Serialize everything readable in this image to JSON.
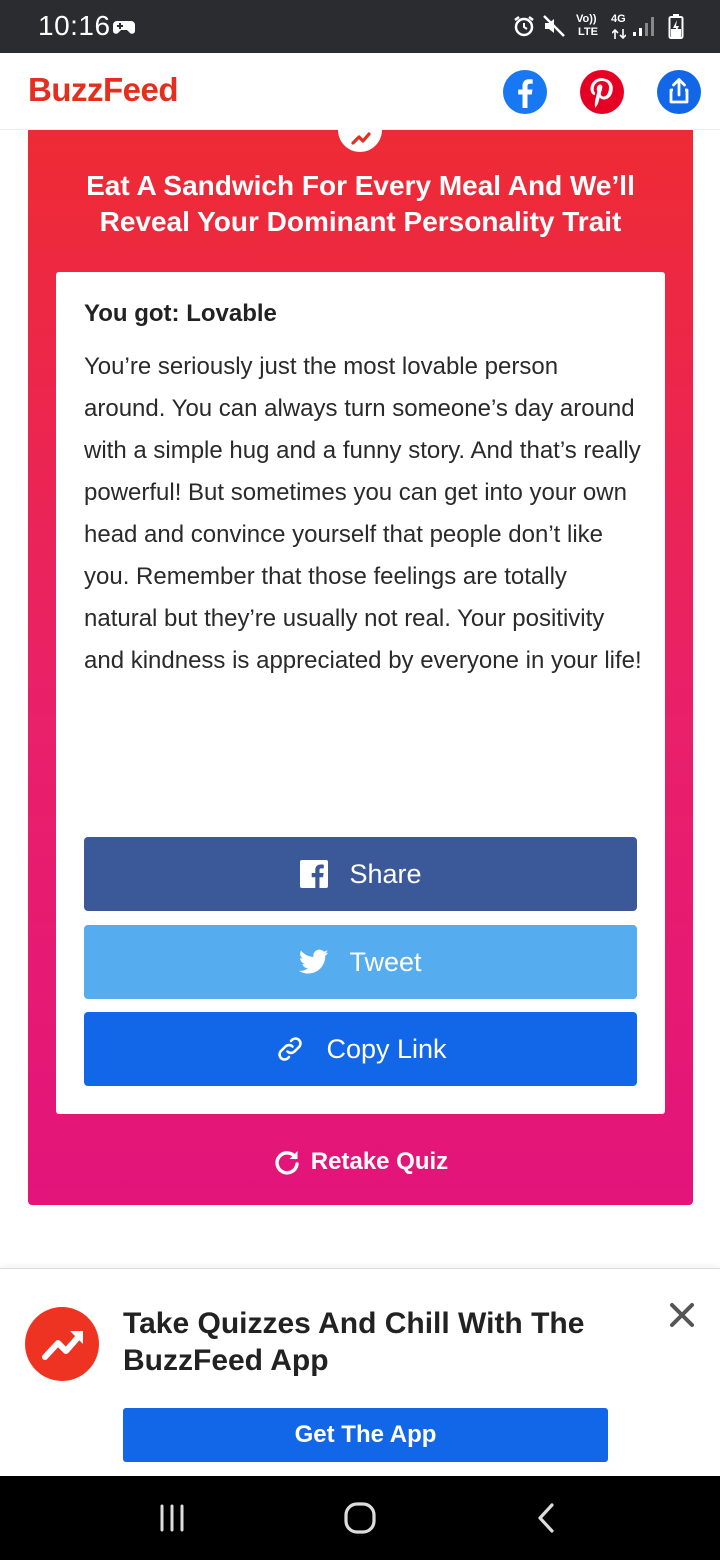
{
  "status_bar": {
    "time": "10:16",
    "volte_top": "Vo))",
    "volte_bottom": "LTE",
    "network": "4G",
    "icons": [
      "game-controller-icon",
      "alarm-icon",
      "mute-icon",
      "signal-icon",
      "battery-charging-icon"
    ]
  },
  "header": {
    "logo": "BuzzFeed",
    "buttons": [
      "facebook-icon",
      "pinterest-icon",
      "share-icon"
    ],
    "brand_color": "#e42e1f"
  },
  "quiz": {
    "title": "Eat A Sandwich For Every Meal And We’ll Reveal Your Dominant Personality Trait",
    "result_heading": "You got: Lovable",
    "result_text": "You’re seriously just the most lovable person around. You can always turn someone’s day around with a simple hug and a funny story. And that’s really powerful! But sometimes you can get into your own head and convince yourself that people don’t like you. Remember that those feelings are totally natural but they’re usually not real. Your positivity and kindness is appreciated by everyone in your life!",
    "share_label": "Share",
    "tweet_label": "Tweet",
    "copy_label": "Copy Link",
    "retake_label": "Retake Quiz",
    "colors": {
      "facebook": "#3b5998",
      "twitter": "#55acee",
      "copy": "#1167e8"
    }
  },
  "promo": {
    "title": "Take Quizzes And Chill With The BuzzFeed App",
    "cta": "Get The App"
  },
  "nav_bar": {
    "buttons": [
      "recents-icon",
      "home-icon",
      "back-icon"
    ]
  }
}
